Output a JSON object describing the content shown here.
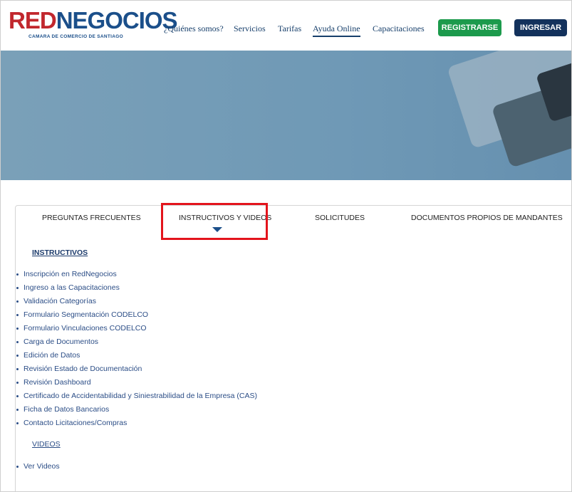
{
  "header": {
    "logo_main_red": "RED",
    "logo_main_blue": "NEGOCIOS",
    "logo_sub": "CAMARA DE COMERCIO DE SANTIAGO",
    "nav": {
      "quienes_somos": "¿Quiénes somos?",
      "servicios": "Servicios",
      "tarifas": "Tarifas",
      "ayuda_online": "Ayuda Online",
      "capacitaciones": "Capacitaciones"
    },
    "register_label": "REGISTRARSE",
    "login_label": "INGRESAR"
  },
  "tabs": {
    "preguntas": "PREGUNTAS FRECUENTES",
    "instructivos": "INSTRUCTIVOS Y VIDEOS",
    "solicitudes": "SOLICITUDES",
    "documentos": "DOCUMENTOS PROPIOS DE MANDANTES"
  },
  "content": {
    "instructivos_title": "INSTRUCTIVOS",
    "instructivos": [
      "Inscripción en RedNegocios",
      "Ingreso a las Capacitaciones",
      "Validación Categorías",
      "Formulario Segmentación CODELCO",
      "Formulario Vinculaciones CODELCO",
      "Carga de Documentos",
      "Edición de Datos",
      "Revisión Estado de Documentación",
      "Revisión Dashboard",
      "Certificado de Accidentabilidad y Siniestrabilidad de la Empresa (CAS)",
      "Ficha de Datos Bancarios",
      "Contacto Licitaciones/Compras"
    ],
    "videos_title": "VIDEOS",
    "videos": [
      "Ver Videos"
    ]
  },
  "colors": {
    "brand_red": "#c1272d",
    "brand_blue": "#1b4f8a",
    "register_green": "#1c9a4c",
    "login_navy": "#13315c",
    "highlight_red": "#e3141c"
  }
}
